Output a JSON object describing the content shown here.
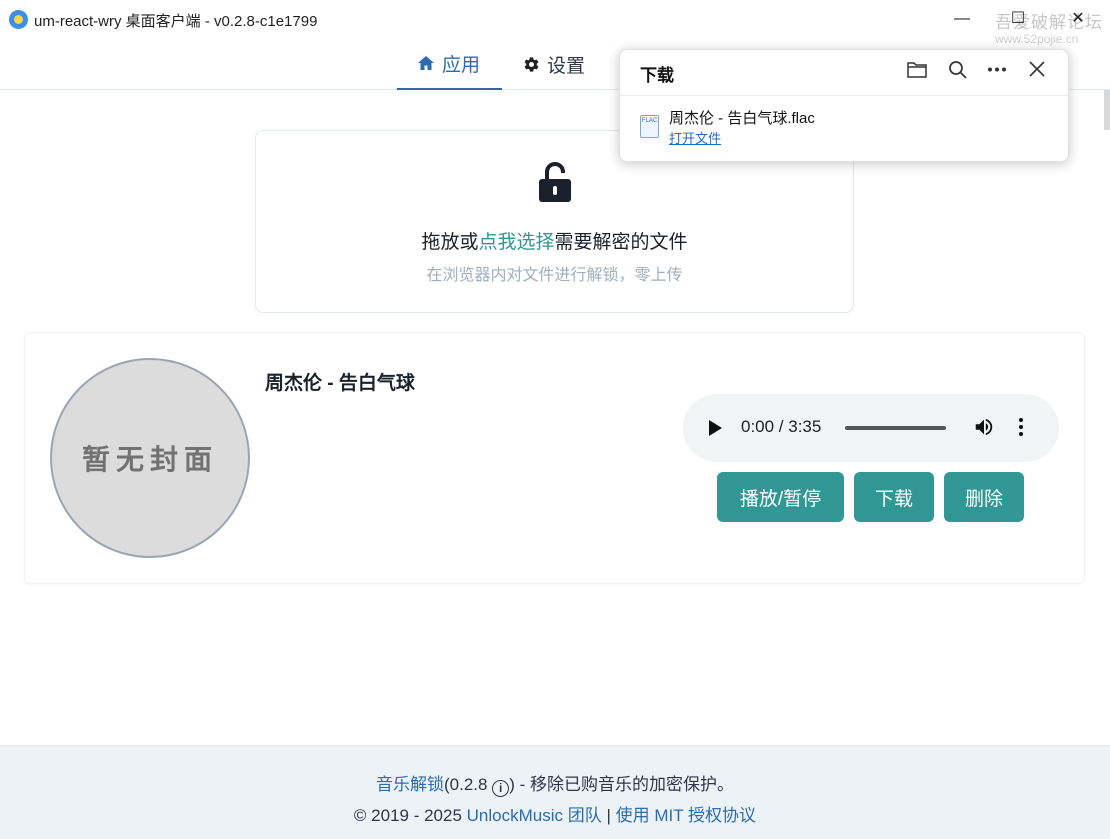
{
  "window": {
    "title": "um-react-wry 桌面客户端 - v0.2.8-c1e1799",
    "minimize": "—",
    "maximize": "☐",
    "close": "✕",
    "watermark": "吾爱破解论坛",
    "watermark_url": "www.52pojie.cn"
  },
  "tabs": [
    {
      "label": "应用",
      "icon": "home-icon",
      "active": true
    },
    {
      "label": "设置",
      "icon": "gear-icon",
      "active": false
    }
  ],
  "dropzone": {
    "title_before": "拖放或",
    "title_link": "点我选择",
    "title_after": "需要解密的文件",
    "subtitle": "在浏览器内对文件进行解锁，零上传",
    "icon": "unlock-icon"
  },
  "track": {
    "cover_placeholder": "暂无封面",
    "title": "周杰伦 - 告白气球",
    "player": {
      "time": "0:00 / 3:35",
      "progress": 0
    },
    "buttons": {
      "play_pause": "播放/暂停",
      "download": "下载",
      "delete": "删除"
    }
  },
  "footer": {
    "app_link": "音乐解锁",
    "version": "(0.2.8",
    "info": "i",
    "after_info": ") - 移除已购音乐的加密保护。",
    "copyright": "© 2019 - 2025",
    "team_link": "UnlockMusic 团队",
    "separator": "|",
    "license_link": "使用 MIT 授权协议"
  },
  "download_popup": {
    "title": "下载",
    "file_name": "周杰伦 - 告白气球.flac",
    "file_type": "FLAC",
    "open_file": "打开文件",
    "icons": [
      "folder-icon",
      "search-icon",
      "more-icon",
      "close-icon"
    ]
  },
  "colors": {
    "accent": "#319795",
    "link": "#2b6cb0",
    "footer_bg": "#edf2f7"
  }
}
